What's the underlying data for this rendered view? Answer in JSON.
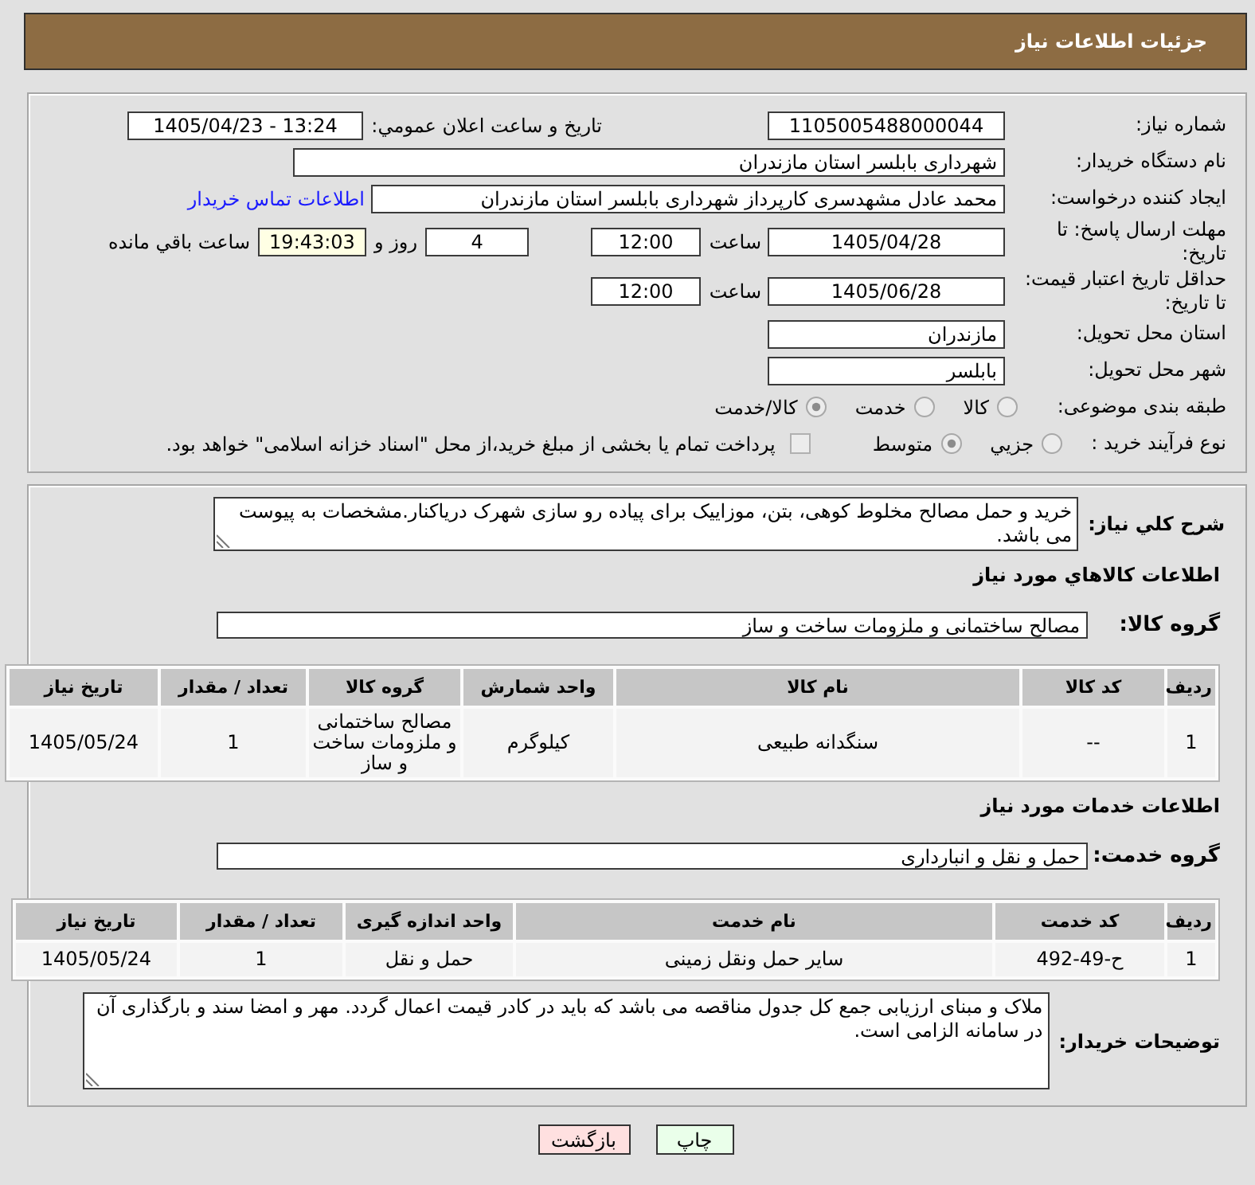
{
  "header": {
    "title": "جزئیات اطلاعات نیاز"
  },
  "need_info": {
    "need_number": {
      "label": "شماره نیاز:",
      "value": "1105005488000044"
    },
    "announce_datetime": {
      "label": "تاریخ و ساعت اعلان عمومي:",
      "value": "1405/04/23 - 13:24"
    },
    "buyer_org": {
      "label": "نام دستگاه خریدار:",
      "value": "شهرداری بابلسر استان مازندران"
    },
    "requester": {
      "label": "ایجاد کننده درخواست:",
      "value": "محمد عادل مشهدسری کارپرداز شهرداری بابلسر استان مازندران",
      "contact_link": "اطلاعات تماس خریدار"
    },
    "response_deadline": {
      "label": "مهلت ارسال پاسخ: تا تاریخ:",
      "date": "1405/04/28",
      "time_label": "ساعت",
      "time": "12:00",
      "days": "4",
      "days_label": "روز و",
      "remaining": "19:43:03",
      "remaining_label": "ساعت باقي مانده"
    },
    "price_validity": {
      "label": "حداقل تاریخ اعتبار قیمت: تا تاریخ:",
      "date": "1405/06/28",
      "time_label": "ساعت",
      "time": "12:00"
    },
    "delivery_province": {
      "label": "استان محل تحویل:",
      "value": "مازندران"
    },
    "delivery_city": {
      "label": "شهر محل تحویل:",
      "value": "بابلسر"
    },
    "subject_category": {
      "label": "طبقه بندی موضوعی:",
      "options": [
        {
          "label": "کالا",
          "selected": false
        },
        {
          "label": "خدمت",
          "selected": false
        },
        {
          "label": "کالا/خدمت",
          "selected": true
        }
      ]
    },
    "purchase_process": {
      "label": "نوع فرآیند خرید :",
      "options": [
        {
          "label": "جزیي",
          "selected": false
        },
        {
          "label": "متوسط",
          "selected": true
        }
      ],
      "treasury_payment": {
        "label": "پرداخت تمام یا بخشی از مبلغ خرید،از محل \"اسناد خزانه اسلامی\" خواهد بود.",
        "checked": false
      }
    }
  },
  "need_description": {
    "label": "شرح کلي نیاز:",
    "value": "خرید و حمل مصالح مخلوط کوهی، بتن، موزاییک برای پیاده رو سازی شهرک دریاکنار.مشخصات به پیوست می باشد."
  },
  "goods": {
    "title": "اطلاعات کالاهاي مورد نیاز",
    "group_label": "گروه کالا:",
    "group": "مصالح ساختمانی و ملزومات ساخت و ساز",
    "table": {
      "columns": [
        "ردیف",
        "کد کالا",
        "نام کالا",
        "واحد شمارش",
        "گروه کالا",
        "تعداد / مقدار",
        "تاریخ نیاز"
      ],
      "rows": [
        [
          "1",
          "--",
          "سنگدانه طبیعی",
          "کیلوگرم",
          "مصالح ساختمانی و ملزومات ساخت و ساز",
          "1",
          "1405/05/24"
        ]
      ]
    }
  },
  "services": {
    "title": "اطلاعات خدمات مورد نیاز",
    "group_label": "گروه خدمت:",
    "group": "حمل و نقل و انبارداری",
    "table": {
      "columns": [
        "ردیف",
        "کد خدمت",
        "نام خدمت",
        "واحد اندازه گیری",
        "تعداد / مقدار",
        "تاریخ نیاز"
      ],
      "rows": [
        [
          "1",
          "ح-49-492",
          "سایر حمل ونقل زمینی",
          "حمل و نقل",
          "1",
          "1405/05/24"
        ]
      ]
    }
  },
  "buyer_notes": {
    "label": "توضیحات خریدار:",
    "value": "ملاک و مبنای ارزیابی جمع کل جدول مناقصه می باشد که باید در کادر قیمت اعمال گردد. مهر و امضا سند و بارگذاری آن در سامانه الزامی است."
  },
  "buttons": [
    {
      "label": "چاپ",
      "kind": "print"
    },
    {
      "label": "بازگشت",
      "kind": "back"
    }
  ]
}
